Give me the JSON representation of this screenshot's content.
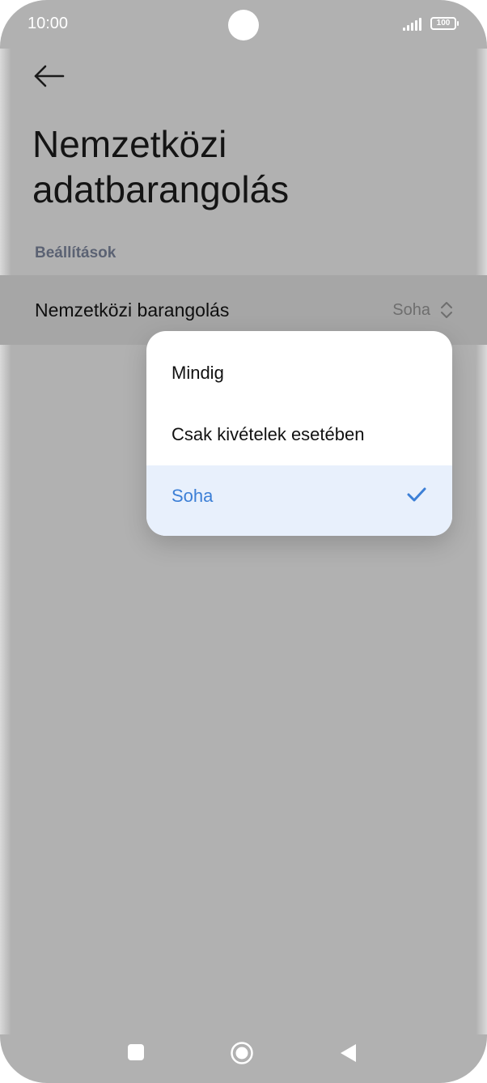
{
  "status_bar": {
    "time": "10:00",
    "battery": "100"
  },
  "icons": {
    "back": "arrow-left-icon",
    "value_selector": "chevron-up-down-icon",
    "selected_check": "checkmark-icon",
    "nav_recents": "square-icon",
    "nav_home": "circle-icon",
    "nav_back": "triangle-left-icon"
  },
  "header": {
    "title": "Nemzetközi adatbarangolás"
  },
  "settings": {
    "section_title": "Beállítások",
    "roaming": {
      "label": "Nemzetközi barangolás",
      "value": "Soha"
    }
  },
  "dropdown": {
    "options": [
      {
        "label": "Mindig",
        "selected": false
      },
      {
        "label": "Csak kivételek esetében",
        "selected": false
      },
      {
        "label": "Soha",
        "selected": true
      }
    ]
  },
  "colors": {
    "accent": "#3c7fd6",
    "selected_bg": "#e8f0fc",
    "dim_overlay": "#b1b1b1"
  }
}
